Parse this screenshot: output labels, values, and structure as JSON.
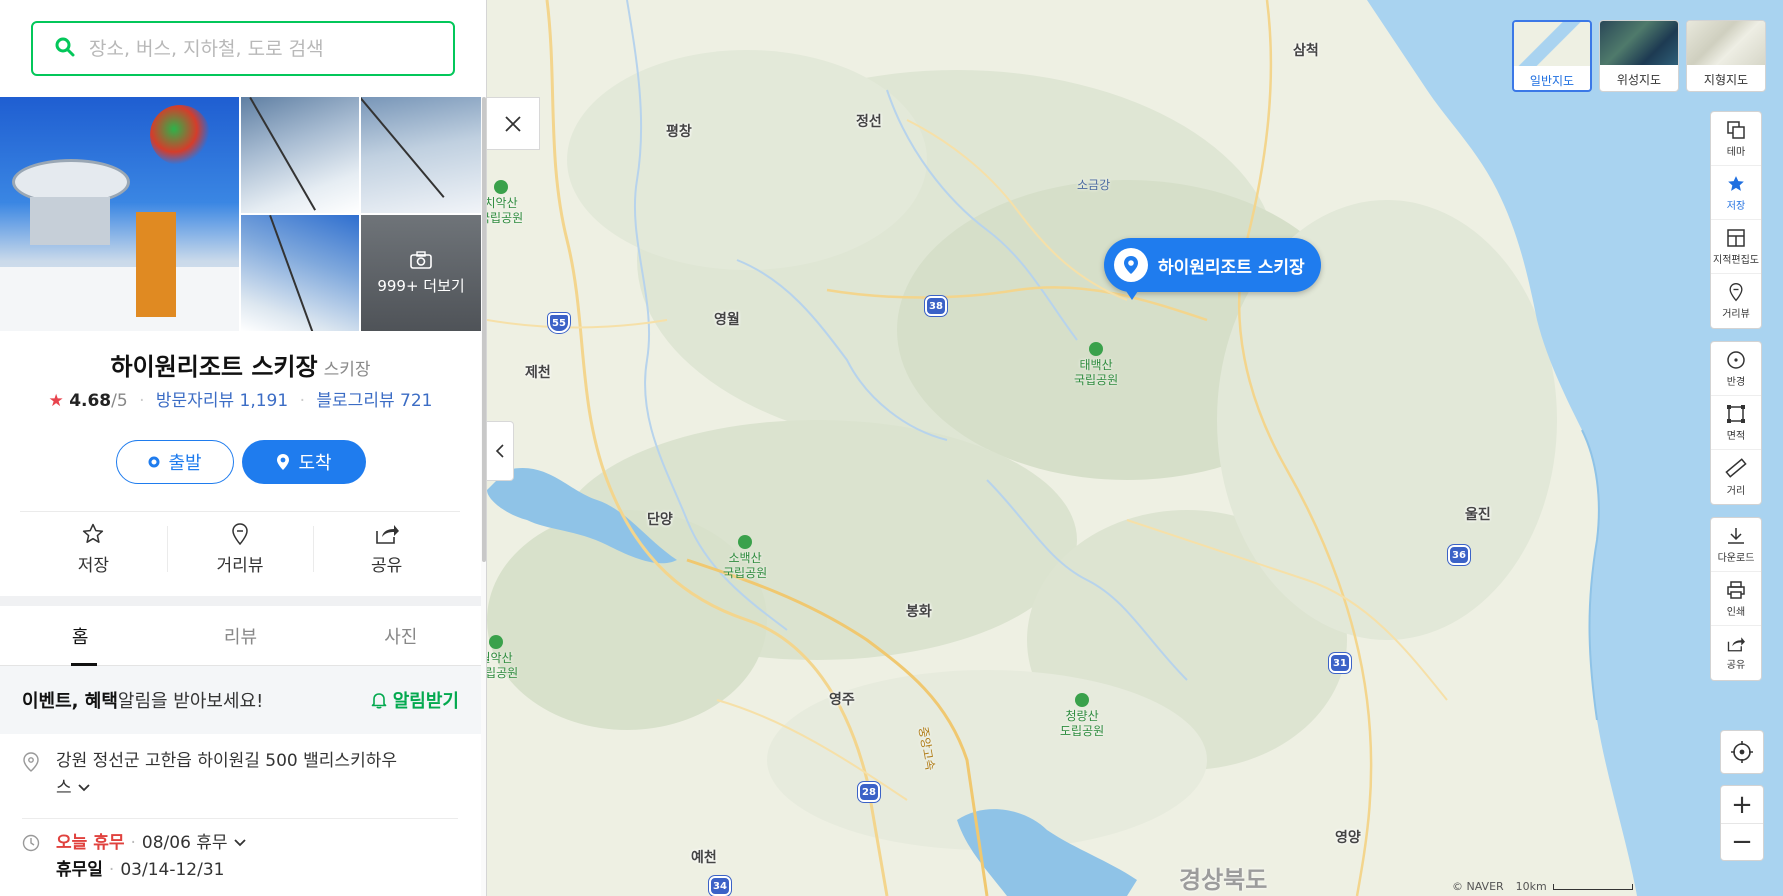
{
  "search": {
    "placeholder": "장소, 버스, 지하철, 도로 검색"
  },
  "place": {
    "name": "하이원리조트 스키장",
    "category": "스키장",
    "rating": "4.68",
    "rating_max": "/5",
    "visitor_reviews": "방문자리뷰 1,191",
    "blog_reviews": "블로그리뷰 721",
    "photos_more": "999+ 더보기"
  },
  "buttons": {
    "depart": "출발",
    "arrive": "도착"
  },
  "actions": {
    "save": "저장",
    "street": "거리뷰",
    "share": "공유"
  },
  "tabs": [
    "홈",
    "리뷰",
    "사진"
  ],
  "notice": {
    "strong": "이벤트, 혜택",
    "text": " 알림을 받아보세요!",
    "button": "알림받기"
  },
  "address": {
    "line1": "강원 정선군 고한읍 하이원길 500 밸리스키하우",
    "line2": "스"
  },
  "hours": {
    "status": "오늘 휴무",
    "date": "08/06 휴무",
    "closed_label": "휴무일",
    "closed_range": "03/14-12/31"
  },
  "map": {
    "pin_label": "하이원리조트 스키장",
    "maptypes": [
      "일반지도",
      "위성지도",
      "지형지도"
    ],
    "tools": [
      "테마",
      "저장",
      "지적편집도",
      "거리뷰",
      "반경",
      "면적",
      "거리",
      "다운로드",
      "인쇄",
      "공유"
    ],
    "places": [
      "삼척",
      "평창",
      "정선",
      "영월",
      "제천",
      "단양",
      "봉화",
      "영주",
      "울진",
      "영양",
      "예천"
    ],
    "river": "소금강",
    "parks": [
      {
        "l1": "치악산",
        "l2": "국립공원"
      },
      {
        "l1": "태백산",
        "l2": "국립공원"
      },
      {
        "l1": "소백산",
        "l2": "국립공원"
      },
      {
        "l1": "월악산",
        "l2": "국립공원"
      },
      {
        "l1": "청량산",
        "l2": "도립공원"
      }
    ],
    "region": "경상북도",
    "shields": [
      "55",
      "38",
      "36",
      "31",
      "28",
      "34"
    ],
    "road_label": "중앙고속",
    "attribution": "© NAVER",
    "scale": "10km"
  },
  "colors": {
    "accent": "#1f7cee",
    "green": "#03c75a",
    "red": "#e0423e"
  }
}
